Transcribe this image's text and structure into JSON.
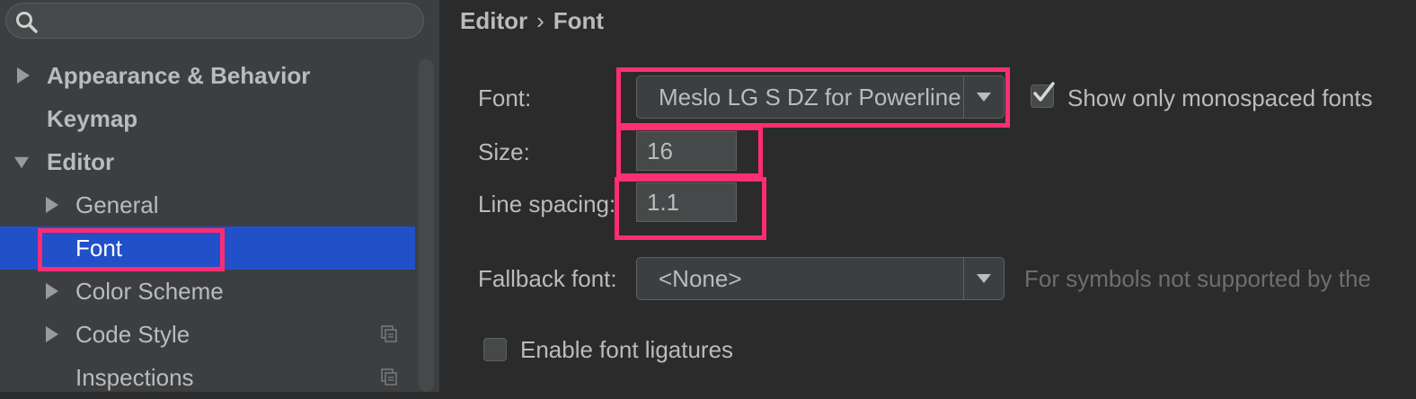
{
  "search": {
    "value": "",
    "placeholder": ""
  },
  "tree": {
    "items": [
      {
        "label": "Appearance & Behavior"
      },
      {
        "label": "Keymap"
      },
      {
        "label": "Editor"
      },
      {
        "label": "General"
      },
      {
        "label": "Font"
      },
      {
        "label": "Color Scheme"
      },
      {
        "label": "Code Style"
      },
      {
        "label": "Inspections"
      }
    ]
  },
  "breadcrumb": {
    "parent": "Editor",
    "separator": "›",
    "current": "Font"
  },
  "form": {
    "font_label": "Font:",
    "font_value": "Meslo LG S DZ for Powerline",
    "show_monospaced_label": "Show only monospaced fonts",
    "show_monospaced_checked": true,
    "size_label": "Size:",
    "size_value": "16",
    "line_spacing_label": "Line spacing:",
    "line_spacing_value": "1.1",
    "fallback_label": "Fallback font:",
    "fallback_value": "<None>",
    "fallback_hint": "For symbols not supported by the",
    "ligatures_label": "Enable font ligatures",
    "ligatures_checked": false
  },
  "colors": {
    "selection": "#2150c8",
    "highlight": "#ff2e72",
    "background": "#2b2b2b",
    "sidebar": "#3c3f41"
  }
}
